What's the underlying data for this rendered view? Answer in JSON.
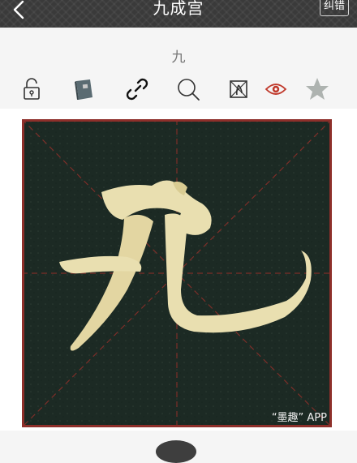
{
  "header": {
    "title": "九成宫",
    "correct_label": "纠错"
  },
  "character": {
    "label": "九"
  },
  "toolbar": {
    "icons": [
      "lock-icon",
      "book-icon",
      "link-icon",
      "search-icon",
      "grid-icon",
      "eye-icon",
      "star-icon"
    ],
    "accent_color": "#c0392b"
  },
  "calligraphy": {
    "character": "九",
    "watermark": "“墨趣” APP"
  }
}
